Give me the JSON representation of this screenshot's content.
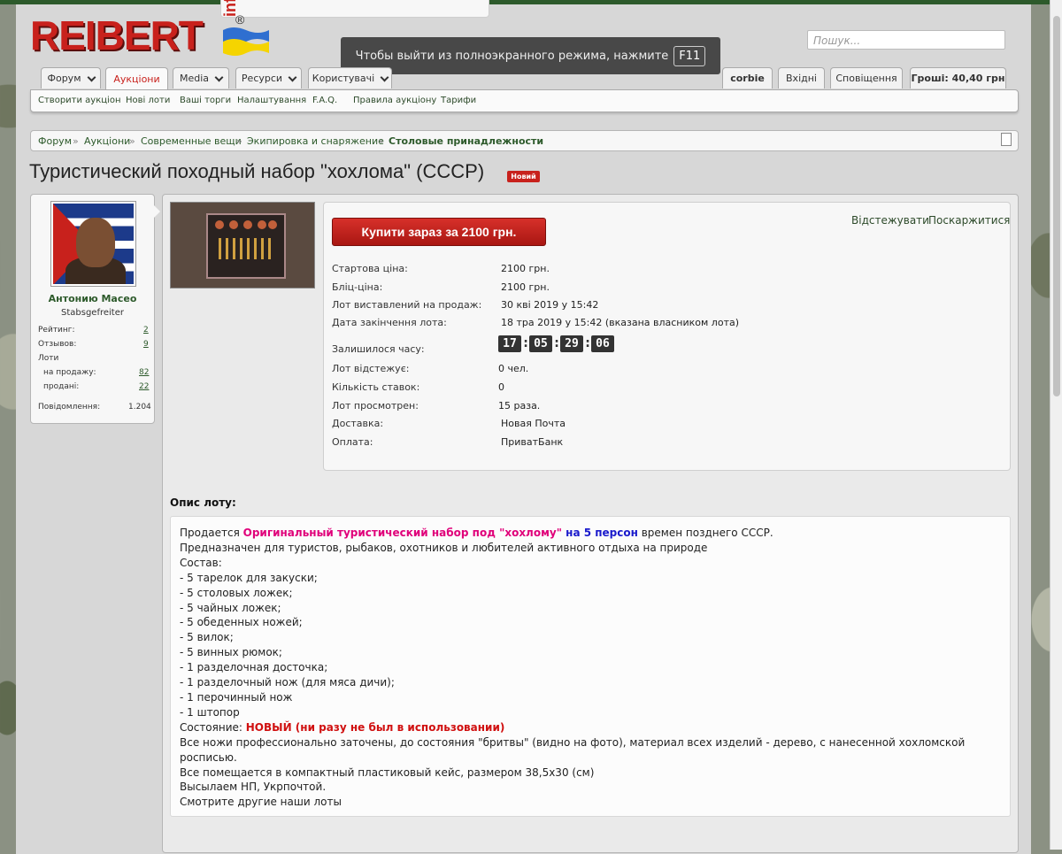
{
  "logo": {
    "text": "REIBERT",
    "suffix": "info",
    "reg": "®"
  },
  "fullscreen": {
    "message": "Чтобы выйти из полноэкранного режима, нажмите",
    "key": "F11"
  },
  "search": {
    "placeholder": "Пошук..."
  },
  "nav": {
    "tabs": [
      {
        "label": "Форум"
      },
      {
        "label": "Аукціони"
      },
      {
        "label": "Media"
      },
      {
        "label": "Ресурси"
      },
      {
        "label": "Користувачі"
      }
    ],
    "user": "corbie",
    "inbox": "Вхідні",
    "alerts": "Сповіщення",
    "money": "Гроші: 40,40 грн"
  },
  "subnav": [
    "Створити аукціон",
    "Нові лоти",
    "Ваші торги",
    "Налаштування",
    "F.A.Q.",
    "Правила аукціону",
    "Тарифи"
  ],
  "breadcrumbs": [
    "Форум",
    "Аукціони",
    "Современные вещи",
    "Экипировка и снаряжение",
    "Столовые принадлежности"
  ],
  "breadcrumb_sep": "»",
  "title": "Туристический походный набор \"хохлома\" (СССР)",
  "badge": "Новий",
  "user_card": {
    "name": "Антонию Масео",
    "rank": "Stabsgefreiter",
    "stats": {
      "rating_label": "Рейтинг:",
      "rating": "2",
      "reviews_label": "Отзывов:",
      "reviews": "9",
      "lots_label": "Лоти",
      "for_sale_label": "на продажу:",
      "for_sale": "82",
      "sold_label": "продані:",
      "sold": "22",
      "messages_label": "Повідомлення:",
      "messages": "1.204"
    }
  },
  "lot": {
    "buy_button": "Купити зараз за 2100 грн.",
    "watch": "Відстежувати",
    "report": "Поскаржитися",
    "rows": [
      {
        "label": "Стартова ціна:",
        "value": "2100 грн."
      },
      {
        "label": "Бліц-ціна:",
        "value": "2100 грн."
      },
      {
        "label": "Лот виставлений на продаж:",
        "value": "30 кві 2019 у 15:42"
      },
      {
        "label": "Дата закінчення лота:",
        "value": "18 тра 2019 у 15:42 (вказана власником лота)"
      }
    ],
    "time_left_label": "Залишилося часу:",
    "timer": [
      "17",
      "05",
      "29",
      "06"
    ],
    "rows2": [
      {
        "label": "Лот відстежує:",
        "value": "0 чел."
      },
      {
        "label": "Кількість ставок:",
        "value": "0"
      },
      {
        "label": "Лот просмотрен:",
        "value": "15 раза."
      },
      {
        "label": "Доставка:",
        "value": "Новая Почта"
      },
      {
        "label": "Оплата:",
        "value": "ПриватБанк"
      }
    ]
  },
  "description": {
    "heading": "Опис лоту:",
    "intro_a": "Продается ",
    "intro_b": "Оригинальный туристический набор под \"хохлому\"",
    "intro_c": " на 5 персон",
    "intro_d": " времен позднего СССР.",
    "lines": [
      "Предназначен для туристов, рыбаков, охотников и любителей активного отдыха на природе",
      "Состав:",
      "- 5 тарелок для закуски;",
      "- 5 столовых ложек;",
      "- 5 чайных ложек;",
      "- 5 обеденных ножей;",
      "- 5 вилок;",
      "- 5 винных рюмок;",
      "- 1 разделочная досточка;",
      "- 1 разделочный нож (для мяса дичи);",
      "- 1 перочинный нож",
      "- 1 штопор"
    ],
    "condition_label": "Состояние: ",
    "condition_value": "НОВЫЙ (ни разу не был в использовании)",
    "tail": [
      "Все ножи профессионально заточены, до состояния \"бритвы\" (видно на фото), материал всех изделий - дерево, с нанесенной хохломской росписью.",
      "Все помещается в компактный пластиковый кейс, размером 38,5х30 (см)",
      "Высылаем НП, Укрпочтой.",
      "Смотрите другие наши лоты"
    ]
  }
}
